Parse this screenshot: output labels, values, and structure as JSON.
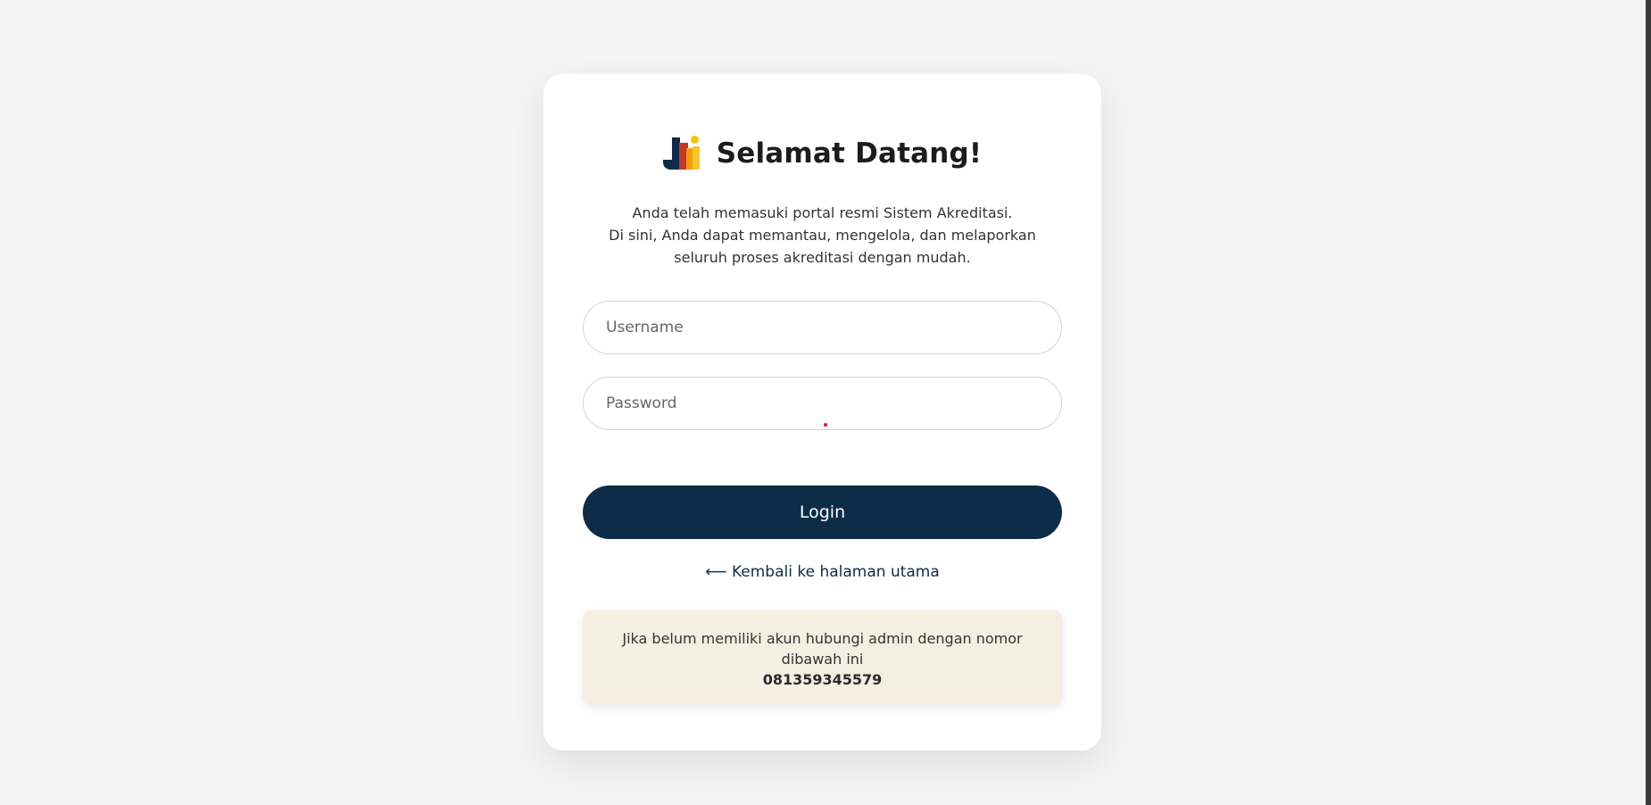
{
  "header": {
    "logo": "jki-logo",
    "title": "Selamat Datang!"
  },
  "description": {
    "line1": "Anda telah memasuki portal resmi Sistem Akreditasi.",
    "line2": "Di sini, Anda dapat memantau, mengelola, dan melaporkan",
    "line3": "seluruh proses akreditasi dengan mudah."
  },
  "form": {
    "username_placeholder": "Username",
    "password_placeholder": "Password",
    "login_label": "Login"
  },
  "back_link": "⟵ Kembali ke halaman utama",
  "notice": {
    "line1": "Jika belum memiliki akun hubungi admin dengan nomor",
    "line2": "dibawah ini",
    "phone": "081359345579"
  },
  "colors": {
    "background": "#f4f4f4",
    "primary": "#0d2c48",
    "notice_bg": "#f5efe2"
  }
}
